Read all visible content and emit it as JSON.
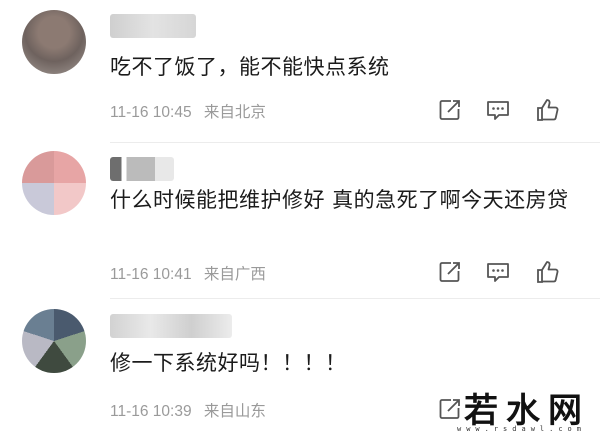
{
  "comments": [
    {
      "content": "吃不了饭了，能不能快点系统",
      "time": "11-16 10:45",
      "location": "来自北京"
    },
    {
      "content": "什么时候能把维护修好 真的急死了啊今天还房贷",
      "time": "11-16 10:41",
      "location": "来自广西"
    },
    {
      "content": "修一下系统好吗！！！！",
      "time": "11-16 10:39",
      "location": "来自山东"
    }
  ],
  "watermark": {
    "text": "若水网",
    "sub": "www.rsdawl.com"
  },
  "colors": {
    "text": "#1b1b1b",
    "meta": "#9a9a9a",
    "icon": "#555555"
  }
}
